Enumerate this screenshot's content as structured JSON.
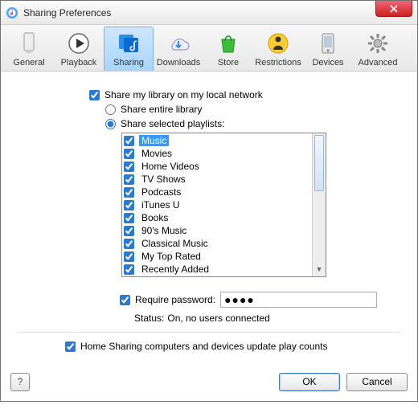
{
  "window": {
    "title": "Sharing Preferences"
  },
  "tabs": {
    "general": "General",
    "playback": "Playback",
    "sharing": "Sharing",
    "downloads": "Downloads",
    "store": "Store",
    "restrictions": "Restrictions",
    "devices": "Devices",
    "advanced": "Advanced"
  },
  "options": {
    "share_library": "Share my library on my local network",
    "share_entire": "Share entire library",
    "share_selected": "Share selected playlists:",
    "require_password": "Require password:",
    "password_masked": "●●●●",
    "status_label": "Status:",
    "status_value": "On, no users connected",
    "home_sharing": "Home Sharing computers and devices update play counts"
  },
  "playlists": [
    "Music",
    "Movies",
    "Home Videos",
    "TV Shows",
    "Podcasts",
    "iTunes U",
    "Books",
    "90's Music",
    "Classical Music",
    "My Top Rated",
    "Recently Added"
  ],
  "buttons": {
    "help": "?",
    "ok": "OK",
    "cancel": "Cancel"
  }
}
